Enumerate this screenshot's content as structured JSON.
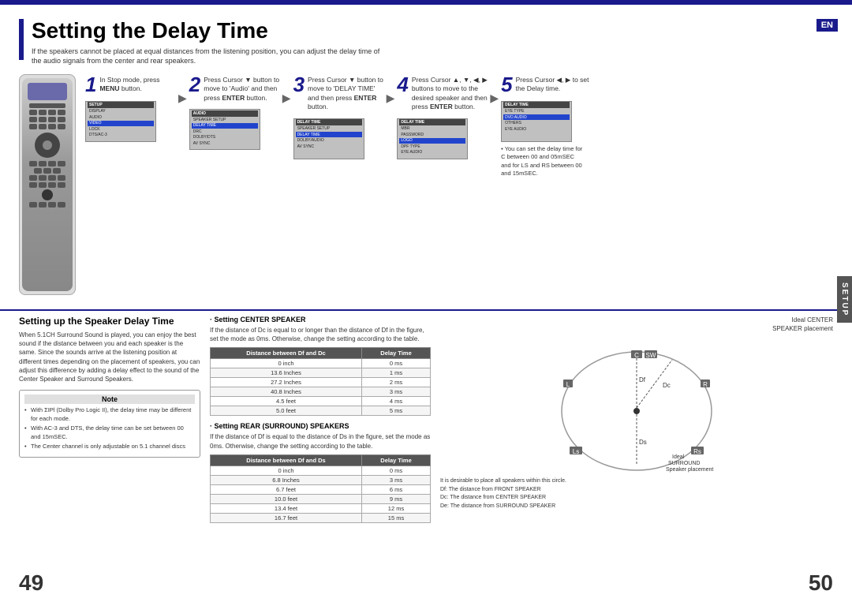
{
  "page": {
    "title": "Setting the Delay Time",
    "subtitle_line1": "If the speakers cannot be placed at equal distances from the listening position, you can adjust the delay time of",
    "subtitle_line2": "the audio signals from the center and rear speakers.",
    "en_badge": "EN",
    "page_left": "49",
    "page_right": "50",
    "setup_tab": "SETUP"
  },
  "steps": [
    {
      "number": "1",
      "description": "In Stop mode, press MENU button.",
      "bold_words": [
        "MENU"
      ]
    },
    {
      "number": "2",
      "description": "Press Cursor ▼ button to move to 'Audio' and then press ENTER button.",
      "bold_words": [
        "ENTER"
      ]
    },
    {
      "number": "3",
      "description": "Press Cursor ▼ button to move to 'DELAY TIME' and then press ENTER button.",
      "bold_words": [
        "ENTER"
      ]
    },
    {
      "number": "4",
      "description": "Press Cursor ▲, ▼, ◀, ▶ buttons to move to the desired speaker and then press ENTER button.",
      "bold_words": [
        "ENTER"
      ]
    },
    {
      "number": "5",
      "description": "Press Cursor ◀, ▶ to set the Delay time.",
      "note": "• You can set the delay time for C between 00 and 05mSEC and for LS and RS between 00 and 15mSEC."
    }
  ],
  "bottom": {
    "section_title": "Setting up the Speaker Delay Time",
    "section_text": "When 5.1CH Surround Sound is played, you can enjoy the best sound if the distance between you and each speaker is the same. Since the sounds arrive at the listening position at different times depending on the placement of speakers, you can adjust this difference by adding a delay effect to the sound of the Center Speaker and Surround Speakers.",
    "note_title": "Note",
    "notes": [
      "With ΣIPl (Dolby Pro Logic II), the delay time may be different for each mode.",
      "With AC-3 and DTS, the delay time can be set between 00 and 15mSEC.",
      "The Center channel is only adjustable on 5.1 channel discs"
    ],
    "center_speaker": {
      "title": "· Setting CENTER SPEAKER",
      "text": "If the distance of Dc is equal to or longer than the distance of Df in the figure, set the mode as 0ms. Otherwise, change the setting according to the table.",
      "table_headers": [
        "Distance between Df and Dc",
        "Delay Time"
      ],
      "table_rows": [
        [
          "0 inch",
          "0 ms"
        ],
        [
          "13.6 Inches",
          "1 ms"
        ],
        [
          "27.2 Inches",
          "2 ms"
        ],
        [
          "40.8 Inches",
          "3 ms"
        ],
        [
          "4.5 feet",
          "4 ms"
        ],
        [
          "5.0 feet",
          "5 ms"
        ]
      ]
    },
    "rear_speaker": {
      "title": "· Setting REAR (SURROUND) SPEAKERS",
      "text": "If the distance of Df is equal to the distance of Ds in the figure, set the mode as 0ms. Otherwise, change the setting according to the table.",
      "table_headers": [
        "Distance between Df and Ds",
        "Delay Time"
      ],
      "table_rows": [
        [
          "0 inch",
          "0 ms"
        ],
        [
          "6.8 Inches",
          "3 ms"
        ],
        [
          "6.7 feet",
          "6 ms"
        ],
        [
          "10.0 feet",
          "9 ms"
        ],
        [
          "13.4 feet",
          "12 ms"
        ],
        [
          "16.7 feet",
          "15 ms"
        ]
      ]
    },
    "diagram": {
      "title_line1": "Ideal CENTER",
      "title_line2": "SPEAKER placement",
      "labels": {
        "C": "C",
        "SW": "SW",
        "L": "L",
        "R": "R",
        "Dc": "Dc",
        "Df": "Df",
        "Ds": "Ds",
        "Ls": "Ls",
        "Rs": "Rs"
      },
      "surround_label": "Ideal SURROUND Speaker placement",
      "note_line1": "It is desirable to place all speakers within this circle.",
      "note_line2": "Df: The distance from FRONT SPEAKER",
      "note_line3": "Dc: The distance from CENTER SPEAKER",
      "note_line4": "De: The distance from SURROUND SPEAKER"
    }
  }
}
